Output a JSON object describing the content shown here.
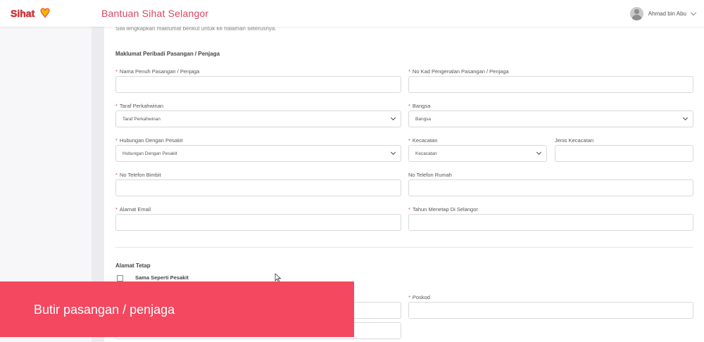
{
  "header": {
    "logo_text": "Sihat",
    "app_title": "Bantuan Sihat Selangor",
    "user_name": "Ahmad bin Abu"
  },
  "form": {
    "intro": "Sila lengkapkan maklumat berikut untuk ke halaman seterusnya.",
    "section_personal": "Maklumat Peribadi Pasangan / Penjaga",
    "fields": {
      "full_name": {
        "label": "Nama Penuh Pasangan / Penjaga",
        "required": true,
        "value": ""
      },
      "ic_number": {
        "label": "No Kad Pengenalan Pasangan / Penjaga",
        "required": true,
        "value": ""
      },
      "marital_status": {
        "label": "Taraf Perkahwinan",
        "required": true,
        "selected": "Taraf Perkahwinan"
      },
      "race": {
        "label": "Bangsa",
        "required": true,
        "selected": "Bangsa"
      },
      "relationship": {
        "label": "Hubungan Dengan Pesakit",
        "required": true,
        "selected": "Hubungan Dengan Pesakit"
      },
      "disability": {
        "label": "Kecacatan",
        "required": true,
        "selected": "Kecacatan"
      },
      "disability_type": {
        "label": "Jenis Kecacatan",
        "required": false,
        "value": ""
      },
      "mobile_phone": {
        "label": "No Telefon Bimbit",
        "required": true,
        "value": ""
      },
      "home_phone": {
        "label": "No Telefon Rumah",
        "required": false,
        "value": ""
      },
      "email": {
        "label": "Alamat Email",
        "required": true,
        "value": ""
      },
      "years_in_selangor": {
        "label": "Tahun Menetap Di Selangor",
        "required": true,
        "value": ""
      },
      "postcode": {
        "label": "Poskod",
        "required": true,
        "value": ""
      }
    },
    "section_address": "Alamat Tetap",
    "same_as_patient_label": "Sama Seperti Pesakit",
    "same_as_patient_checked": false,
    "required_marker": "*"
  },
  "overlay": {
    "caption": "Butir pasangan / penjaga"
  },
  "colors": {
    "accent": "#d9455f",
    "banner": "#f34860"
  }
}
